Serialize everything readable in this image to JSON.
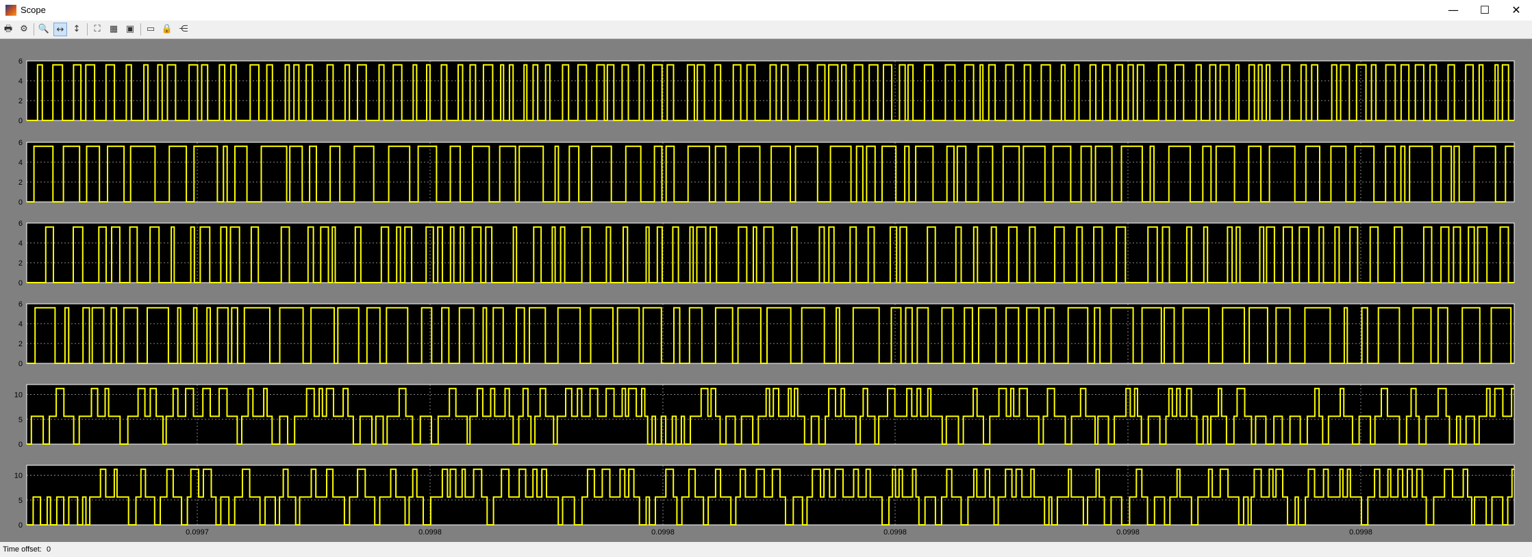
{
  "window": {
    "title": "Scope",
    "minimize_glyph": "—",
    "maximize_glyph": "☐",
    "close_glyph": "✕"
  },
  "toolbar": {
    "buttons": [
      {
        "name": "print-icon",
        "glyph": "🖶"
      },
      {
        "name": "parameters-icon",
        "glyph": "⚙"
      },
      {
        "name": "zoom-icon",
        "glyph": "🔍"
      },
      {
        "name": "zoom-x-icon",
        "glyph": "↔"
      },
      {
        "name": "zoom-y-icon",
        "glyph": "↕"
      },
      {
        "name": "autoscale-icon",
        "glyph": "⛶"
      },
      {
        "name": "save-axes-icon",
        "glyph": "▦"
      },
      {
        "name": "restore-axes-icon",
        "glyph": "▣"
      },
      {
        "name": "floating-scope-icon",
        "glyph": "▭"
      },
      {
        "name": "lock-axes-icon",
        "glyph": "🔒"
      },
      {
        "name": "signal-selection-icon",
        "glyph": "⋲"
      }
    ]
  },
  "colors": {
    "plot_background": "#000000",
    "trace": "#ffff00",
    "grid": "#c8c8c8",
    "figure_background": "#808080"
  },
  "chart_data": [
    {
      "type": "line",
      "ylim": [
        0,
        6
      ],
      "yticks": [
        "0",
        "2",
        "4",
        "6"
      ],
      "levels": [
        0,
        5.6
      ],
      "xticks": [
        "0.0997",
        "0.0998",
        "0.0998",
        "0.0998",
        "0.0998",
        "0.0998"
      ],
      "grid": true
    },
    {
      "type": "line",
      "ylim": [
        0,
        6
      ],
      "yticks": [
        "0",
        "2",
        "4",
        "6"
      ],
      "levels": [
        0,
        5.6
      ],
      "grid": true
    },
    {
      "type": "line",
      "ylim": [
        0,
        6
      ],
      "yticks": [
        "0",
        "2",
        "4",
        "6"
      ],
      "levels": [
        0,
        5.6
      ],
      "grid": true
    },
    {
      "type": "line",
      "ylim": [
        0,
        6
      ],
      "yticks": [
        "0",
        "2",
        "4",
        "6"
      ],
      "levels": [
        0,
        5.6
      ],
      "grid": true
    },
    {
      "type": "line",
      "ylim": [
        0,
        12
      ],
      "yticks": [
        "0",
        "5",
        "10"
      ],
      "levels": [
        0,
        5.6,
        11.2
      ],
      "grid": true
    },
    {
      "type": "line",
      "ylim": [
        0,
        12
      ],
      "yticks": [
        "0",
        "5",
        "10"
      ],
      "levels": [
        0,
        5.6,
        11.2
      ],
      "grid": true
    }
  ],
  "xaxis": {
    "tick_labels": [
      "0.0997",
      "0.0998",
      "0.0998",
      "0.0998",
      "0.0998",
      "0.0998"
    ]
  },
  "status": {
    "time_offset_label": "Time offset:",
    "time_offset_value": "0"
  }
}
